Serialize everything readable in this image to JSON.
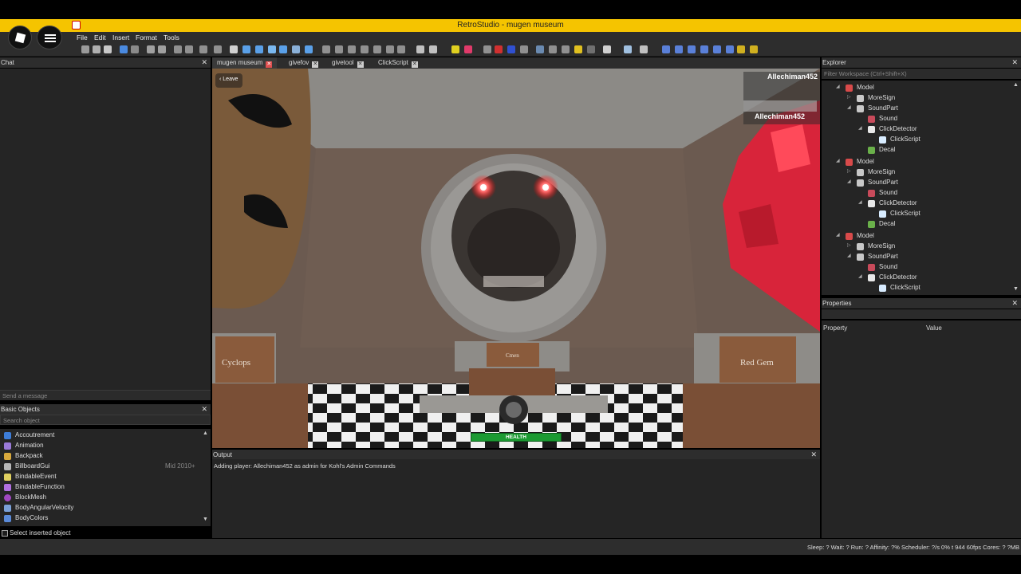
{
  "window": {
    "title": "RetroStudio - mugen museum"
  },
  "menu": [
    "File",
    "Edit",
    "Insert",
    "Format",
    "Tools"
  ],
  "chat": {
    "header": "Chat",
    "placeholder": "Send a message"
  },
  "basic_objects": {
    "header": "Basic Objects",
    "placeholder": "Search object",
    "items": [
      {
        "label": "Accoutrement",
        "icon": "accoutrement-icon",
        "color": "#3d7dd8",
        "tag": ""
      },
      {
        "label": "Animation",
        "icon": "animation-icon",
        "color": "#9a7ad8",
        "tag": ""
      },
      {
        "label": "Backpack",
        "icon": "backpack-icon",
        "color": "#d8a93d",
        "tag": ""
      },
      {
        "label": "BillboardGui",
        "icon": "billboardgui-icon",
        "color": "#b8b8b8",
        "tag": "Mid 2010+"
      },
      {
        "label": "BindableEvent",
        "icon": "bindableevent-icon",
        "color": "#e0d060",
        "tag": ""
      },
      {
        "label": "BindableFunction",
        "icon": "bindablefunction-icon",
        "color": "#b070e0",
        "tag": ""
      },
      {
        "label": "BlockMesh",
        "icon": "blockmesh-icon",
        "color": "#a048c0",
        "tag": ""
      },
      {
        "label": "BodyAngularVelocity",
        "icon": "bodyangularvelocity-icon",
        "color": "#7aa0d8",
        "tag": ""
      },
      {
        "label": "BodyColors",
        "icon": "bodycolors-icon",
        "color": "#5a8ad8",
        "tag": ""
      }
    ],
    "select_inserted": "Select inserted object"
  },
  "tabs": [
    {
      "label": "mugen museum",
      "active": true
    },
    {
      "label": "givefov",
      "active": false
    },
    {
      "label": "givetool",
      "active": false
    },
    {
      "label": "ClickScript",
      "active": false
    }
  ],
  "viewport": {
    "leave": "Leave",
    "player_top": "Allechiman452",
    "player_list_name": "Allechiman452",
    "health": "HEALTH",
    "health_fraction": 1.0,
    "signs": {
      "left": "Cyclops",
      "right": "Red Gem",
      "center": "Cmen"
    }
  },
  "output": {
    "header": "Output",
    "lines": [
      "Adding player: Allechiman452 as admin for Kohl's Admin Commands"
    ]
  },
  "explorer": {
    "header": "Explorer",
    "filter_placeholder": "Filter Workspace (Ctrl+Shift+X)",
    "rows": [
      {
        "label": "Model",
        "depth": 0,
        "type": "model"
      },
      {
        "label": "MoreSign",
        "depth": 1,
        "type": "part"
      },
      {
        "label": "SoundPart",
        "depth": 1,
        "type": "part"
      },
      {
        "label": "Sound",
        "depth": 2,
        "type": "sound"
      },
      {
        "label": "ClickDetector",
        "depth": 2,
        "type": "click"
      },
      {
        "label": "ClickScript",
        "depth": 3,
        "type": "script"
      },
      {
        "label": "Decal",
        "depth": 2,
        "type": "decal"
      },
      {
        "label": "Model",
        "depth": 0,
        "type": "model"
      },
      {
        "label": "MoreSign",
        "depth": 1,
        "type": "part"
      },
      {
        "label": "SoundPart",
        "depth": 1,
        "type": "part"
      },
      {
        "label": "Sound",
        "depth": 2,
        "type": "sound"
      },
      {
        "label": "ClickDetector",
        "depth": 2,
        "type": "click"
      },
      {
        "label": "ClickScript",
        "depth": 3,
        "type": "script"
      },
      {
        "label": "Decal",
        "depth": 2,
        "type": "decal"
      },
      {
        "label": "Model",
        "depth": 0,
        "type": "model"
      },
      {
        "label": "MoreSign",
        "depth": 1,
        "type": "part"
      },
      {
        "label": "SoundPart",
        "depth": 1,
        "type": "part"
      },
      {
        "label": "Sound",
        "depth": 2,
        "type": "sound"
      },
      {
        "label": "ClickDetector",
        "depth": 2,
        "type": "click"
      },
      {
        "label": "ClickScript",
        "depth": 3,
        "type": "script"
      }
    ]
  },
  "properties": {
    "header": "Properties",
    "col_property": "Property",
    "col_value": "Value"
  },
  "status": "Sleep: ? Wait: ? Run: ? Affinity: ?% Scheduler: ?/s 0%   t 944   60fps   Cores: ?   ?MB"
}
